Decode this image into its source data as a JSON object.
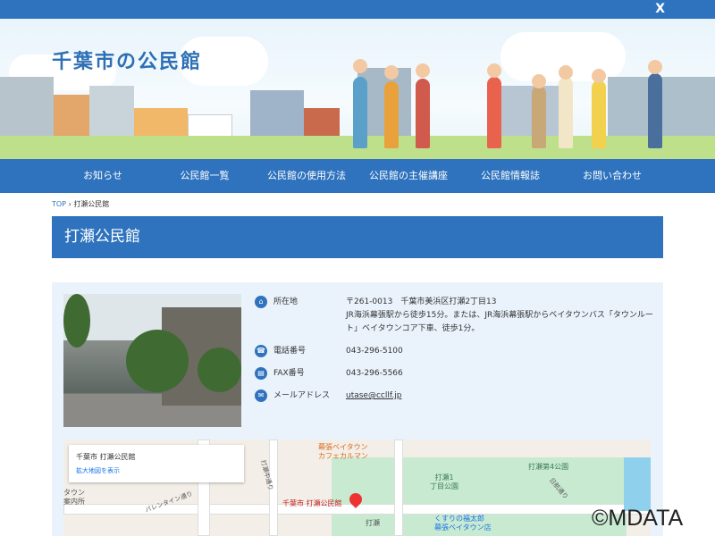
{
  "header": {
    "site_title": "千葉市の公民館",
    "x_icon": "X"
  },
  "nav": [
    "お知らせ",
    "公民館一覧",
    "公民館の使用方法",
    "公民館の主催講座",
    "公民館情報誌",
    "お問い合わせ"
  ],
  "breadcrumb": {
    "top": "TOP",
    "sep": "›",
    "current": "打瀬公民館"
  },
  "page_title": "打瀬公民館",
  "info": {
    "address_label": "所在地",
    "address_line1": "〒261-0013　千葉市美浜区打瀬2丁目13",
    "address_line2": "JR海浜幕張駅から徒歩15分。または、JR海浜幕張駅からベイタウンバス「タウンルート」ベイタウンコア下車、徒歩1分。",
    "phone_label": "電話番号",
    "phone": "043-296-5100",
    "fax_label": "FAX番号",
    "fax": "043-296-5566",
    "email_label": "メールアドレス",
    "email": "utase@ccllf.jp"
  },
  "map": {
    "place_name": "千葉市 打瀬公民館",
    "enlarge_link": "拡大地図を表示",
    "labels": {
      "cafe": "幕張ベイタウン\nカフェカルマン",
      "street1": "打瀬中通り",
      "street2": "パレンタイン通り",
      "park1": "打瀬1\n丁目公園",
      "park4": "打瀬第4公園",
      "street3": "日航通り",
      "pin_label": "千葉市 打瀬公民館",
      "area": "打瀬",
      "pharmacy": "くすりの福太郎\n幕張ベイタウン店",
      "info": "タウン\n案内所"
    }
  },
  "watermark": "©MDATA"
}
